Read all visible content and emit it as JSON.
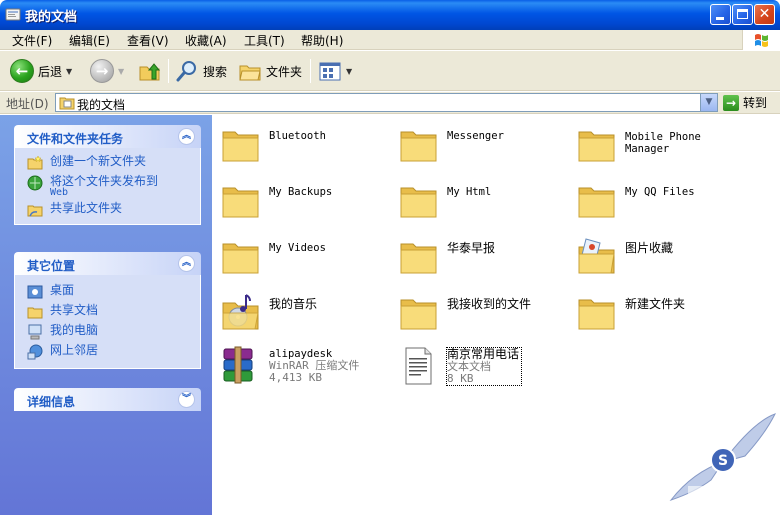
{
  "window": {
    "title": "我的文档"
  },
  "menubar": {
    "items": [
      {
        "label": "文件(F)"
      },
      {
        "label": "编辑(E)"
      },
      {
        "label": "查看(V)"
      },
      {
        "label": "收藏(A)"
      },
      {
        "label": "工具(T)"
      },
      {
        "label": "帮助(H)"
      }
    ]
  },
  "toolbar": {
    "back_label": "后退",
    "search_label": "搜索",
    "folders_label": "文件夹"
  },
  "address": {
    "label": "地址(D)",
    "value": "我的文档",
    "go_label": "转到"
  },
  "taskpane": {
    "panels": [
      {
        "title": "文件和文件夹任务",
        "state": "expanded",
        "links": [
          {
            "label": "创建一个新文件夹",
            "icon": "new-folder-icon"
          },
          {
            "label": "将这个文件夹发布到",
            "sub": "Web",
            "icon": "publish-web-icon"
          },
          {
            "label": "共享此文件夹",
            "icon": "share-folder-icon"
          }
        ]
      },
      {
        "title": "其它位置",
        "state": "expanded",
        "links": [
          {
            "label": "桌面",
            "icon": "desktop-icon"
          },
          {
            "label": "共享文档",
            "icon": "shared-docs-icon"
          },
          {
            "label": "我的电脑",
            "icon": "my-computer-icon"
          },
          {
            "label": "网上邻居",
            "icon": "network-icon"
          }
        ]
      },
      {
        "title": "详细信息",
        "state": "collapsed"
      }
    ]
  },
  "files": [
    {
      "name": "Bluetooth",
      "type": "folder"
    },
    {
      "name": "Messenger",
      "type": "folder"
    },
    {
      "name": "Mobile Phone",
      "name2": "Manager",
      "type": "folder"
    },
    {
      "name": "My Backups",
      "type": "folder"
    },
    {
      "name": "My Html",
      "type": "folder"
    },
    {
      "name": "My QQ Files",
      "type": "folder"
    },
    {
      "name": "My Videos",
      "type": "folder"
    },
    {
      "name": "华泰早报",
      "type": "folder"
    },
    {
      "name": "图片收藏",
      "type": "pictures-folder"
    },
    {
      "name": "我的音乐",
      "type": "music-folder"
    },
    {
      "name": "我接收到的文件",
      "type": "folder"
    },
    {
      "name": "新建文件夹",
      "type": "folder"
    },
    {
      "name": "alipaydesk",
      "type": "rar-archive",
      "desc": "WinRAR 压缩文件",
      "size": "4,413 KB"
    },
    {
      "name": "南京常用电话",
      "type": "text-document",
      "desc": "文本文档",
      "size": "8 KB",
      "selected": true
    }
  ],
  "colors": {
    "titlebar": "#0055e5",
    "taskpane_link": "#215dc6",
    "taskpane_bg": "#7ba2e7",
    "folder_yellow": "#f5d36b"
  }
}
